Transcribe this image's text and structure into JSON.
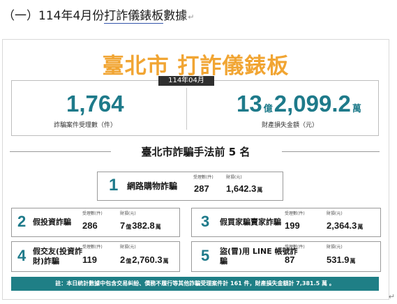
{
  "doc": {
    "heading_prefix": "（一）114年4月份",
    "heading_underlined": "打詐儀錶板",
    "heading_suffix": "數據",
    "para_mark": "↵"
  },
  "infographic": {
    "title": "臺北市  打詐儀錶板",
    "month": "114年04月",
    "summary": {
      "case_count": "1,764",
      "case_label": "詐騙案件受理數（件）",
      "loss_amount_yi": "13",
      "loss_unit_yi": "億",
      "loss_amount_wan": "2,099.2",
      "loss_unit_wan": "萬",
      "loss_label": "財產損失金額（元）"
    },
    "section_title": "臺北市詐騙手法前 5 名",
    "cases_label": "受理數(件)",
    "loss_label": "財損(元)",
    "rankings": [
      {
        "rank": "1",
        "name": "網路購物詐騙",
        "cases": "287",
        "loss_main": "1,642.3",
        "loss_unit": "萬"
      },
      {
        "rank": "2",
        "name": "假投資詐騙",
        "cases": "286",
        "loss_yi": "7",
        "loss_yi_unit": "億",
        "loss_main": "382.8",
        "loss_unit": "萬"
      },
      {
        "rank": "3",
        "name": "假買家騙賣家詐騙",
        "cases": "199",
        "loss_main": "2,364.3",
        "loss_unit": "萬"
      },
      {
        "rank": "4",
        "name_line1": "假交友(投資詐",
        "name_line2": "財)詐騙",
        "cases": "119",
        "loss_yi": "2",
        "loss_yi_unit": "億",
        "loss_main": "2,760.3",
        "loss_unit": "萬"
      },
      {
        "rank": "5",
        "name_line1": "盜(冒)用 LINE 帳號詐",
        "name_line2": "騙",
        "cases": "87",
        "loss_main": "531.9",
        "loss_unit": "萬"
      }
    ],
    "footer": "註：本日統計數據中包含交易糾紛、債務不履行等其他詐騙受理案件計 161 件，財產損失金額計 7,381.5 萬 。"
  },
  "colors": {
    "title": "#f1a533",
    "accent": "#1e7a8a",
    "footer_bg": "#1f7f86"
  }
}
